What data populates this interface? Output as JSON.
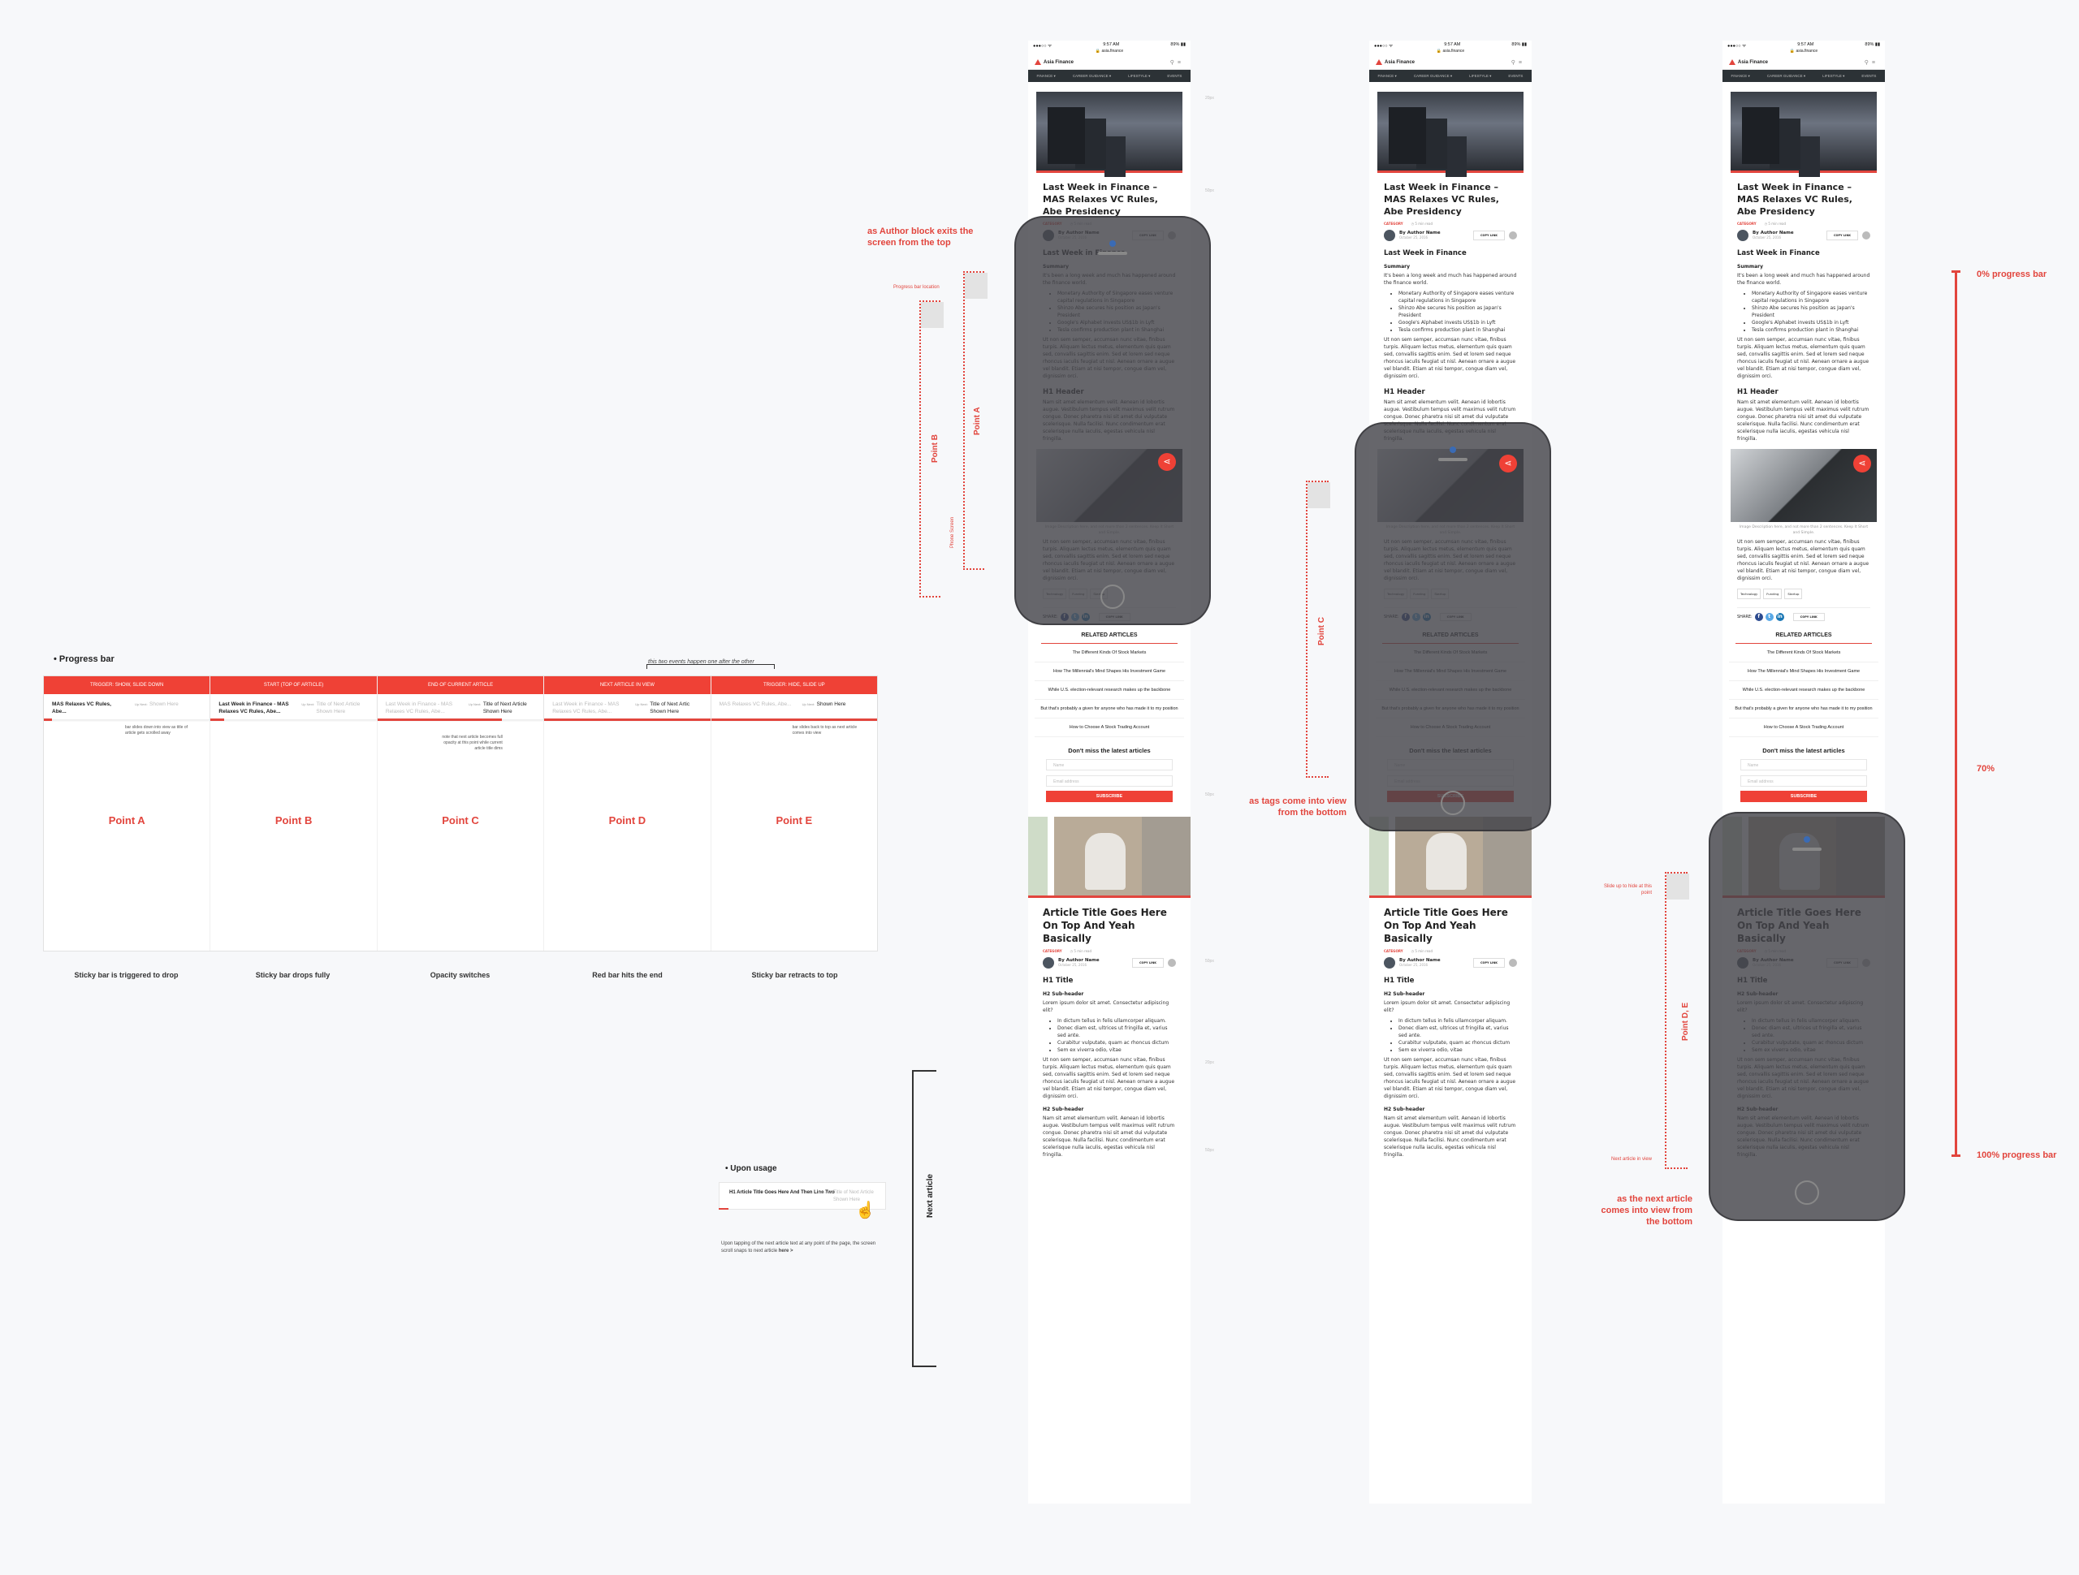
{
  "progress_section": {
    "title": "• Progress bar",
    "note": "this two events happen one after the other",
    "columns": [
      {
        "header": "TRIGGER: SHOW, SLIDE DOWN",
        "current": "MAS Relaxes VC Rules, Abe...",
        "up_next": "Up Next:",
        "next": "Shown Here",
        "desc": "bar slides down into view as title of article gets scrolled away",
        "point": "Point A",
        "caption": "Sticky bar is triggered to drop",
        "progress": 0.05
      },
      {
        "header": "START (TOP OF ARTICLE)",
        "current": "Last Week in Finance - MAS Relaxes VC Rules, Abe...",
        "up_next": "Up Next:",
        "next": "Title of Next Article Shown Here",
        "desc": "",
        "point": "Point B",
        "caption": "Sticky bar drops fully",
        "progress": 0.08
      },
      {
        "header": "END OF CURRENT ARTICLE",
        "current": "Last Week in Finance - MAS Relaxes VC Rules, Abe...",
        "up_next": "Up Next:",
        "next": "Title of Next Article Shown Here",
        "desc": "note that next article becomes full opacity at this point while current article title dims",
        "point": "Point C",
        "caption": "Opacity switches",
        "progress": 0.75
      },
      {
        "header": "NEXT ARTICLE IN VIEW",
        "current": "Last Week in Finance - MAS Relaxes VC Rules, Abe...",
        "up_next": "Up Next:",
        "next": "Title of Next Artic Shown Here",
        "desc": "",
        "point": "Point D",
        "caption": "Red bar hits the end",
        "progress": 1.0
      },
      {
        "header": "TRIGGER: HIDE, SLIDE UP",
        "current": "MAS Relaxes VC Rules, Abe...",
        "up_next": "Up Next:",
        "next": "Shown Here",
        "desc": "bar slides back to top as next article comes into view",
        "point": "Point E",
        "caption": "Sticky bar retracts to top",
        "progress": 1.0
      }
    ]
  },
  "usage": {
    "title": "• Upon usage",
    "current": "H1 Article Title Goes Here And Then Line Two",
    "up_next": "Next Article",
    "next": "Title of Next Article Shown Here",
    "desc": "Upon tapping of the next article text at any point of the page, the screen scroll snaps to next article",
    "desc_link": "here >",
    "bracket_label": "Next article"
  },
  "mockup": {
    "status_carrier": "●●●○○ ᯤ",
    "status_time": "9:57 AM",
    "status_battery": "89% ▮▮",
    "url": "🔒 asia.finance",
    "brand": "Asia Finance",
    "nav": [
      "FINANCE ▾",
      "CAREER GUIDANCE ▾",
      "LIFESTYLE ▾",
      "EVENTS"
    ],
    "article1": {
      "title": "Last Week in Finance – MAS Relaxes VC Rules, Abe Presidency",
      "category": "CATEGORY",
      "read_time": "◷ 5 min read",
      "author": "By Author Name",
      "date": "October 25, 2016",
      "copy_link": "COPY LINK",
      "h2": "Last Week in Finance",
      "summary_label": "Summary",
      "summary": "It's been a long week and much has happened around the finance world.",
      "bullets": [
        "Monetary Authority of Singapore eases venture capital regulations in Singapore",
        "Shinzo Abe secures his position as Japan's President",
        "Google's Alphabet invests US$1b in Lyft",
        "Tesla confirms production plant in Shanghai"
      ],
      "para1": "Ut non sem semper, accumsan nunc vitae, finibus turpis. Aliquam lectus metus, elementum quis quam sed, convallis sagittis enim. Sed et lorem sed neque rhoncus iaculis feugiat ut nisl. Aenean ornare a augue vel blandit. Etiam at nisi tempor, congue diam vel, dignissim orci.",
      "h1": "H1 Header",
      "para2": "Nam sit amet elementum velit. Aenean id lobortis augue. Vestibulum tempus velit maximus velit rutrum congue. Donec pharetra nisi sit amet dui vulputate scelerisque. Nulla facilisi. Nunc condimentum erat scelerisque nulla iaculis, egestas vehicula nisl fringilla.",
      "caption": "Image Description here, and not more than 2 sentences. Keep It Short and Simple.",
      "para3": "Ut non sem semper, accumsan nunc vitae, finibus turpis. Aliquam lectus metus, elementum quis quam sed, convallis sagittis enim. Sed et lorem sed neque rhoncus iaculis feugiat ut nisl. Aenean ornare a augue vel blandit. Etiam at nisi tempor, congue diam vel, dignissim orci.",
      "tags": [
        "Technology",
        "Funding",
        "Startup"
      ],
      "share_label": "SHARE:"
    },
    "related": {
      "title": "RELATED ARTICLES",
      "items": [
        "The Different Kinds Of Stock Markets",
        "How The Millennial's Mind Shapes His Investment Game",
        "While U.S. election-relevant research makes up the backbone",
        "But that's probably a given for anyone who has made it to my position",
        "How to Choose A Stock Trading Account"
      ]
    },
    "subscribe": {
      "title": "Don't miss the latest articles",
      "name_placeholder": "Name",
      "email_placeholder": "Email address",
      "button": "SUBSCRIBE"
    },
    "article2": {
      "title": "Article Title Goes Here On Top And Yeah Basically",
      "category": "CATEGORY",
      "read_time": "◷ 5 min read",
      "author": "By Author Name",
      "date": "October 25, 2016",
      "copy_link": "COPY LINK",
      "h1": "H1 Title",
      "h2": "H2 Sub-header",
      "intro": "Lorem ipsum dolor sit amet. Consectetur adipiscing elit?",
      "bullets": [
        "In dictum tellus in felis ullamcorper aliquam.",
        "Donec diam est, ultrices ut fringilla et, varius sed ante.",
        "Curabitur vulputate, quam ac rhoncus dictum",
        "Sem ex viverra odio, vitae"
      ],
      "para1": "Ut non sem semper, accumsan nunc vitae, finibus turpis. Aliquam lectus metus, elementum quis quam sed, convallis sagittis enim. Sed et lorem sed neque rhoncus iaculis feugiat ut nisl. Aenean ornare a augue vel blandit. Etiam at nisi tempor, congue diam vel, dignissim orci.",
      "h2b": "H2 Sub-header",
      "para2": "Nam sit amet elementum velit. Aenean id lobortis augue. Vestibulum tempus velit maximus velit rutrum congue. Donec pharetra nisi sit amet dui vulputate scelerisque. Nulla facilisi. Nunc condimentum erat scelerisque nulla iaculis, egestas vehicula nisl fringilla."
    }
  },
  "annotations": {
    "author_exit": "as Author block exits the screen from the top",
    "progress_location": "Progress bar location",
    "point_a": "Point A",
    "point_b": "Point B",
    "phone_screen": "Phone Screen",
    "point_c": "Point C",
    "tags_view": "as tags come into view from the bottom",
    "slide_up": "Slide up to hide at this point",
    "point_de": "Point D, E",
    "next_in_view": "Next article in view",
    "next_comes": "as the next article comes into view from the bottom",
    "pct0": "0% progress bar",
    "pct70": "70%",
    "pct100": "100% progress bar",
    "spacing": [
      "20px",
      "50px",
      "50px",
      "50px",
      "20px",
      "50px"
    ]
  },
  "colors": {
    "accent": "#e2453d",
    "bar_red": "#ef4136",
    "nav_dark": "#2c3236"
  }
}
